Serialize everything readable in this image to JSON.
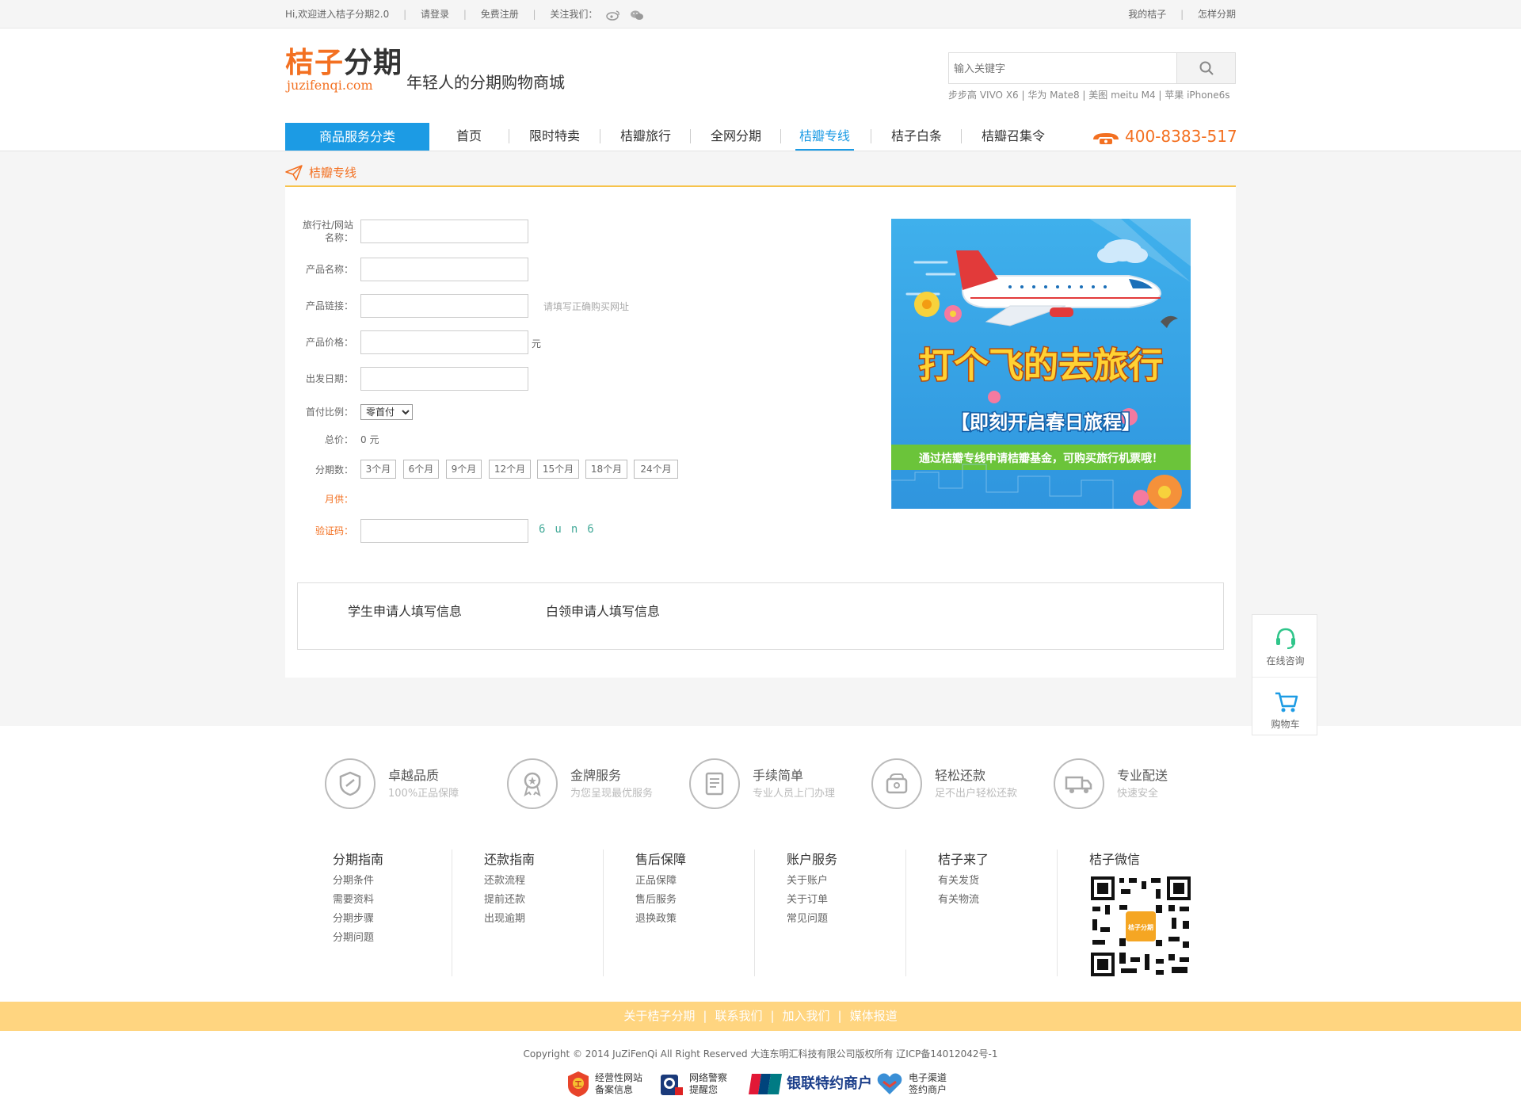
{
  "topbar": {
    "welcome": "Hi,欢迎进入桔子分期2.0",
    "login": "请登录",
    "register": "免费注册",
    "follow": "关注我们：",
    "icons": [
      "weibo-icon",
      "wechat-icon"
    ],
    "my_juzi": "我的桔子",
    "how_to": "怎样分期"
  },
  "header": {
    "logo_zh_1": "桔子",
    "logo_zh_2": "分期",
    "logo_en": "juzifenqi.com",
    "slogan": "年轻人的分期购物商城",
    "search_placeholder": "输入关键字",
    "hotwords": "步步高 VIVO X6 | 华为 Mate8 | 美图 meitu M4 | 苹果 iPhone6s"
  },
  "nav": {
    "category_button": "商品服务分类",
    "items": [
      "首页",
      "限时特卖",
      "桔瓣旅行",
      "全网分期",
      "桔瓣专线",
      "桔子白条",
      "桔瓣召集令"
    ],
    "active": "桔瓣专线",
    "phone": "400-8383-517"
  },
  "section": {
    "title": "桔瓣专线"
  },
  "form": {
    "agency_label_1": "旅行社/网站",
    "agency_label_2": "名称：",
    "product_name_label": "产品名称：",
    "product_link_label": "产品链接：",
    "product_link_hint": "请填写正确购买网址",
    "price_label": "产品价格：",
    "price_unit": "元",
    "depart_label": "出发日期：",
    "down_label": "首付比例：",
    "down_value": "零首付",
    "total_label": "总价：",
    "total_value": "0 元",
    "periods_label": "分期数：",
    "periods": [
      "3个月",
      "6个月",
      "9个月",
      "12个月",
      "15个月",
      "18个月",
      "24个月"
    ],
    "monthly_label": "月供：",
    "captcha_label": "验证码：",
    "captcha_text": "6un6",
    "student_apply": "学生申请人填写信息",
    "whitecollar_apply": "白领申请人填写信息"
  },
  "banner": {
    "headline": "打个飞的去旅行",
    "subhead": "【即刻开启春日旅程】",
    "note": "通过桔瓣专线申请桔瓣基金，可购买旅行机票哦！"
  },
  "float": {
    "consult": "在线咨询",
    "cart": "购物车"
  },
  "features": [
    {
      "title": "卓越品质",
      "desc": "100%正品保障",
      "icon": "shield-icon"
    },
    {
      "title": "金牌服务",
      "desc": "为您呈现最优服务",
      "icon": "medal-icon"
    },
    {
      "title": "手续简单",
      "desc": "专业人员上门办理",
      "icon": "document-icon"
    },
    {
      "title": "轻松还款",
      "desc": "足不出户轻松还款",
      "icon": "wallet-icon"
    },
    {
      "title": "专业配送",
      "desc": "快速安全",
      "icon": "truck-icon"
    }
  ],
  "footer_cols": [
    {
      "title": "分期指南",
      "links": [
        "分期条件",
        "需要资料",
        "分期步骤",
        "分期问题"
      ]
    },
    {
      "title": "还款指南",
      "links": [
        "还款流程",
        "提前还款",
        "出现逾期"
      ]
    },
    {
      "title": "售后保障",
      "links": [
        "正品保障",
        "售后服务",
        "退换政策"
      ]
    },
    {
      "title": "账户服务",
      "links": [
        "关于账户",
        "关于订单",
        "常见问题"
      ]
    },
    {
      "title": "桔子来了",
      "links": [
        "有关发货",
        "有关物流"
      ]
    },
    {
      "title": "桔子微信",
      "links": []
    }
  ],
  "qr_label": "桔子分期",
  "bottom_links": [
    "关于桔子分期",
    "联系我们",
    "加入我们",
    "媒体报道"
  ],
  "copyright": "Copyright © 2014 JuZiFenQi All Right Reserved 大连东明汇科技有限公司版权所有 辽ICP备14012042号-1",
  "badges": [
    {
      "l1": "经营性网站",
      "l2": "备案信息"
    },
    {
      "l1": "网络警察",
      "l2": "提醒您"
    },
    {
      "l1": "银联特约商户",
      "l2": ""
    },
    {
      "l1": "电子渠道",
      "l2": "签约商户"
    }
  ],
  "colors": {
    "brand_orange": "#f37021",
    "nav_blue": "#1c9be4",
    "footer_yellow": "#ffd580"
  }
}
